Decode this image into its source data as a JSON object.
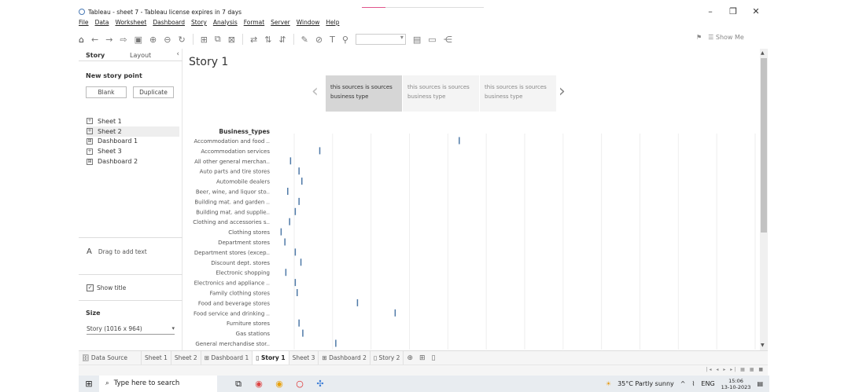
{
  "window": {
    "title": "Tableau - sheet 7 - Tableau license expires in 7 days",
    "minimize": "–",
    "maximize": "❐",
    "close": "✕"
  },
  "menu": [
    "File",
    "Data",
    "Worksheet",
    "Dashboard",
    "Story",
    "Analysis",
    "Format",
    "Server",
    "Window",
    "Help"
  ],
  "toolbar": {
    "show_me": "Show Me"
  },
  "side_panel": {
    "tab_story": "Story",
    "tab_layout": "Layout",
    "collapse": "‹",
    "new_story_point": "New story point",
    "blank_button": "Blank",
    "duplicate_button": "Duplicate",
    "sheets": [
      {
        "label": "Sheet 1",
        "type": "sheet"
      },
      {
        "label": "Sheet 2",
        "type": "sheet"
      },
      {
        "label": "Dashboard 1",
        "type": "dashboard"
      },
      {
        "label": "Sheet 3",
        "type": "sheet"
      },
      {
        "label": "Dashboard 2",
        "type": "dashboard"
      }
    ],
    "drag_text": "Drag to add text",
    "show_title": "Show title",
    "size_heading": "Size",
    "size_value": "Story (1016 x 964)"
  },
  "story": {
    "title": "Story 1",
    "points": [
      "this sources is sources business type",
      "this sources is sources business type",
      "this sources is sources business type"
    ],
    "prev_arrow": "‹",
    "next_arrow": "›"
  },
  "chart_data": {
    "type": "bar",
    "title": "",
    "ylabel": "Business_types",
    "categories": [
      "Accommodation and food ..",
      "Accommodation services",
      "All other general merchan..",
      "Auto parts and tire stores",
      "Automobile dealers",
      "Beer, wine, and liquor sto..",
      "Building mat. and garden ..",
      "Building mat. and supplie..",
      "Clothing and accessories s..",
      "Clothing stores",
      "Department stores",
      "Department stores (excep..",
      "Discount dept. stores",
      "Electronic shopping",
      "Electronics and appliance ..",
      "Family clothing stores",
      "Food and beverage stores",
      "Food service and drinking ..",
      "Furniture stores",
      "Gas stations",
      "General merchandise stor.."
    ],
    "values": [
      186,
      38,
      7,
      16,
      19,
      4,
      16,
      12,
      6,
      -3,
      1,
      12,
      18,
      2,
      12,
      14,
      78,
      118,
      16,
      20,
      55
    ],
    "xlim": [
      -10,
      500
    ],
    "grid": true,
    "mark_color": "#4e79a7"
  },
  "tabs": [
    {
      "label": "Data Source",
      "icon": "🗄"
    },
    {
      "label": "Sheet 1"
    },
    {
      "label": "Sheet 2"
    },
    {
      "label": "Dashboard 1",
      "icon": "⊞"
    },
    {
      "label": "Story 1",
      "icon": "▯",
      "active": true
    },
    {
      "label": "Sheet 3"
    },
    {
      "label": "Dashboard 2",
      "icon": "⊞"
    },
    {
      "label": "Story 2",
      "icon": "▯"
    }
  ],
  "taskbar": {
    "search_placeholder": "Type here to search",
    "weather": "35°C  Partly sunny",
    "lang": "ENG",
    "time": "15:06",
    "date": "13-10-2023"
  }
}
